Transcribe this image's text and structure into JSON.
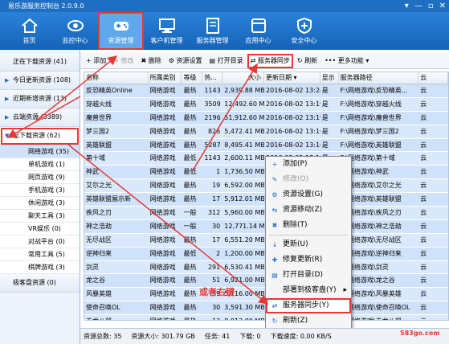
{
  "window": {
    "title": "易乐游服务控制台 2.0.9.0",
    "buttons": [
      "▾",
      "—",
      "▫",
      "✕"
    ]
  },
  "nav": [
    {
      "label": "首页",
      "icon": "home-icon"
    },
    {
      "label": "监控中心",
      "icon": "eye-icon"
    },
    {
      "label": "资源管理",
      "icon": "gamepad-icon"
    },
    {
      "label": "客户机管理",
      "icon": "monitor-icon"
    },
    {
      "label": "服务器管理",
      "icon": "server-icon"
    },
    {
      "label": "应用中心",
      "icon": "apps-icon"
    },
    {
      "label": "安全中心",
      "icon": "shield-icon"
    }
  ],
  "sidebar": {
    "items": [
      {
        "label": "正在下载资源 (41)"
      },
      {
        "label": "今日更新资源 (108)"
      },
      {
        "label": "近期新增资源 (13)"
      },
      {
        "label": "云端资源 (3389)"
      },
      {
        "label": "已下载资源 (62)"
      }
    ],
    "sub": [
      {
        "label": "网络游戏 (35)"
      },
      {
        "label": "单机游戏 (1)"
      },
      {
        "label": "网页游戏 (9)"
      },
      {
        "label": "手机游戏 (3)"
      },
      {
        "label": "休闲游戏 (3)"
      },
      {
        "label": "聊天工具 (3)"
      },
      {
        "label": "VR娱乐 (0)"
      },
      {
        "label": "对战平台 (0)"
      },
      {
        "label": "常用工具 (5)"
      },
      {
        "label": "棋牌游戏 (3)"
      }
    ],
    "bottom": {
      "label": "极客盘资源 (0)"
    }
  },
  "toolbar": [
    {
      "label": "+ 添加",
      "disabled": false
    },
    {
      "label": "✎ 修改",
      "disabled": true
    },
    {
      "label": "✖ 删除",
      "disabled": false
    },
    {
      "label": "⚙ 资源设置",
      "disabled": false
    },
    {
      "label": "▤ 打开目录",
      "disabled": false
    },
    {
      "label": "⇄ 服务器同步",
      "disabled": false
    },
    {
      "label": "↻ 刷新",
      "disabled": false
    },
    {
      "label": "••• 更多功能 ▾",
      "disabled": false
    }
  ],
  "table": {
    "columns": [
      "名称",
      "所属类别",
      "等级",
      "热...",
      "大小",
      "更新日期 ▾",
      "显示",
      "服务器路径",
      "云"
    ],
    "rows": [
      [
        "反恐精英Online",
        "网络游戏",
        "最热",
        "1143",
        "2,939.88 MB",
        "2016-08-02 13:24:17",
        "是",
        "F:\\网络游戏\\反恐精英...",
        "云"
      ],
      [
        "穿越火线",
        "网络游戏",
        "最热",
        "3509",
        "12,492.60 MB",
        "2016-08-02 13:19:17",
        "是",
        "F:\\网络游戏\\穿越火线",
        "云"
      ],
      [
        "魔兽世界",
        "网络游戏",
        "最热",
        "2196",
        "51,912.60 MB",
        "2016-08-02 13:19:17",
        "是",
        "F:\\网络游戏\\魔兽世界",
        "云"
      ],
      [
        "梦三国2",
        "网络游戏",
        "最热",
        "826",
        "5,472.41 MB",
        "2016-08-02 13:16:25",
        "是",
        "F:\\网络游戏\\梦三国2",
        "云"
      ],
      [
        "英雄联盟",
        "网络游戏",
        "最热",
        "5287",
        "8,495.41 MB",
        "2016-08-02 13:16:25",
        "是",
        "F:\\网络游戏\\英雄联盟",
        "云"
      ],
      [
        "第十域",
        "网络游戏",
        "最低",
        "1143",
        "2,600.11 MB",
        "2016-08-02 13:16:25",
        "是",
        "F:\\网络游戏\\第十域",
        "云"
      ],
      [
        "神武",
        "网络游戏",
        "最低",
        "1",
        "1,736.50 MB",
        "2016-08-02 13:16:25",
        "是",
        "F:\\网络游戏\\神武",
        "云"
      ],
      [
        "艾尔之光",
        "网络游戏",
        "最热",
        "19",
        "6,592.00 MB",
        "2016-08-02 13:16:25",
        "是",
        "F:\\网络游戏\\艾尔之光",
        "云"
      ],
      [
        "英雄联盟展示新",
        "网络游戏",
        "最热",
        "17",
        "5,912.01 MB",
        "2016-08-02 13:16:25",
        "是",
        "F:\\网络游戏\\英雄联盟",
        "云"
      ],
      [
        "疾风之刃",
        "网络游戏",
        "一般",
        "312",
        "5,960.00 MB",
        "2016-08-02 13:16:25",
        "是",
        "F:\\网络游戏\\疾风之刃",
        "云"
      ],
      [
        "神之浩劫",
        "网络游戏",
        "一般",
        "30",
        "12,771.14 MB",
        "2016-08-02 13:16:25",
        "是",
        "F:\\网络游戏\\神之浩劫",
        "云"
      ],
      [
        "无尽战区",
        "网络游戏",
        "最热",
        "17",
        "6,551.20 MB",
        "2016-08-02 13:16:25",
        "是",
        "F:\\网络游戏\\无尽战区",
        "云"
      ],
      [
        "逆神归来",
        "网络游戏",
        "最低",
        "2",
        "1,200.00 MB",
        "2016-08-02 13:16:25",
        "是",
        "F:\\网络游戏\\逆神归来",
        "云"
      ],
      [
        "剑灵",
        "网络游戏",
        "最热",
        "291",
        "6,530.41 MB",
        "2016-08-02 13:16:25",
        "是",
        "F:\\网络游戏\\剑灵",
        "云"
      ],
      [
        "龙之谷",
        "网络游戏",
        "最热",
        "51",
        "6,921.00 MB",
        "2016-08-02 13:16:25",
        "是",
        "F:\\网络游戏\\龙之谷",
        "云"
      ],
      [
        "风暴英雄",
        "网络游戏",
        "最热",
        "39",
        "5,116.00 MB",
        "2016-08-02 13:16:25",
        "是",
        "F:\\网络游戏\\风暴英雄",
        "云"
      ],
      [
        "使命召唤OL",
        "网络游戏",
        "最热",
        "30",
        "3,591.30 MB",
        "2016-08-02 13:16:25",
        "是",
        "F:\\网络游戏\\使命召唤OL",
        "云"
      ],
      [
        "天龙八部",
        "网络游戏",
        "最热",
        "12",
        "8,012.00 MB",
        "2016-08-02 13:16:25",
        "是",
        "F:\\网络游戏\\天龙八部",
        "云"
      ]
    ]
  },
  "context_menu": [
    {
      "label": "添加(P)",
      "icon": "+",
      "disabled": false,
      "sep_after": false
    },
    {
      "label": "修改(O)",
      "icon": "✎",
      "disabled": true,
      "sep_after": false
    },
    {
      "label": "资源设置(G)",
      "icon": "⚙",
      "disabled": false,
      "sep_after": false
    },
    {
      "label": "资源移动(Z)",
      "icon": "⇆",
      "disabled": false,
      "sep_after": false
    },
    {
      "label": "删除(T)",
      "icon": "✖",
      "disabled": false,
      "sep_after": true
    },
    {
      "label": "更新(U)",
      "icon": "↓",
      "disabled": false,
      "sep_after": false
    },
    {
      "label": "修复更新(R)",
      "icon": "✚",
      "disabled": false,
      "sep_after": false
    },
    {
      "label": "打开目录(D)",
      "icon": "▤",
      "disabled": false,
      "sep_after": false
    },
    {
      "label": "部署到极客盘(Y)",
      "icon": "",
      "disabled": false,
      "sep_after": false,
      "submenu": true
    },
    {
      "label": "服务器同步(Y)",
      "icon": "⇄",
      "disabled": false,
      "sep_after": false,
      "highlight": true
    },
    {
      "label": "刷新(Z)",
      "icon": "↻",
      "disabled": false,
      "sep_after": false
    }
  ],
  "status": {
    "total": "资源总数: 35",
    "size": "资源大小: 301.79 GB",
    "tasks": "任务: 41",
    "down": "下载: 0",
    "speed": "下载速度: 0.00 KB/S"
  },
  "annotation": "或者右键",
  "watermark": "583go.com",
  "colors": {
    "accent": "#1e6fc2",
    "highlight": "#e53935",
    "row": "#d9e8fb"
  }
}
